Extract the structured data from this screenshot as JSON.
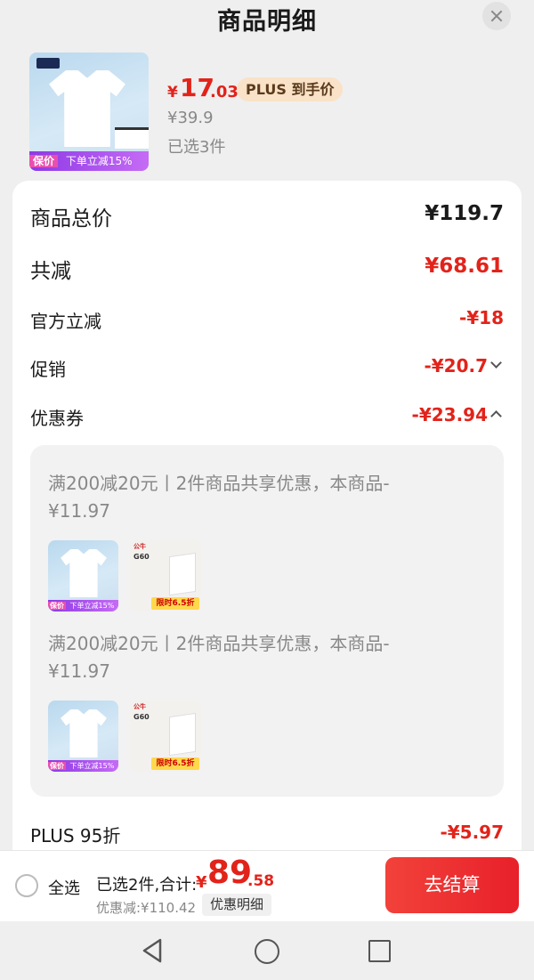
{
  "header": {
    "title": "商品明细"
  },
  "product": {
    "currency": "¥",
    "price_integer": "17",
    "price_decimal": ".03",
    "plus_tag": "PLUS 到手价",
    "original_price": "¥39.9",
    "selected_count": "已选3件",
    "thumb_promo_tag": "保价",
    "thumb_promo_text": "下单立减15%"
  },
  "summary": {
    "total_label": "商品总价",
    "total_value": "¥119.7",
    "reduce_label": "共减",
    "reduce_value": "¥68.61",
    "official_label": "官方立减",
    "official_value": "-¥18",
    "promo_label": "促销",
    "promo_value": "-¥20.7",
    "coupon_label": "优惠券",
    "coupon_value": "-¥23.94",
    "plus_label": "PLUS 95折",
    "plus_value": "-¥5.97"
  },
  "coupons": [
    {
      "text": "满200减20元丨2件商品共享优惠，本商品-¥11.97"
    },
    {
      "text": "满200减20元丨2件商品共享优惠，本商品-¥11.97"
    }
  ],
  "coupon_thumb2": {
    "brand": "公牛",
    "model": "G60",
    "sale_tag": "限时6.5折"
  },
  "bottom": {
    "select_all": "全选",
    "total_prefix": "已选2件,合计:",
    "total_yen": "¥",
    "total_integer": "89",
    "total_decimal": ".58",
    "discount_total": "优惠减:¥110.42",
    "detail_button": "优惠明细",
    "checkout_button": "去结算"
  },
  "colors": {
    "accent_red": "#e2231a",
    "plus_pill_bg": "#f9e2c7",
    "promo_purple": "#8d39e6"
  }
}
